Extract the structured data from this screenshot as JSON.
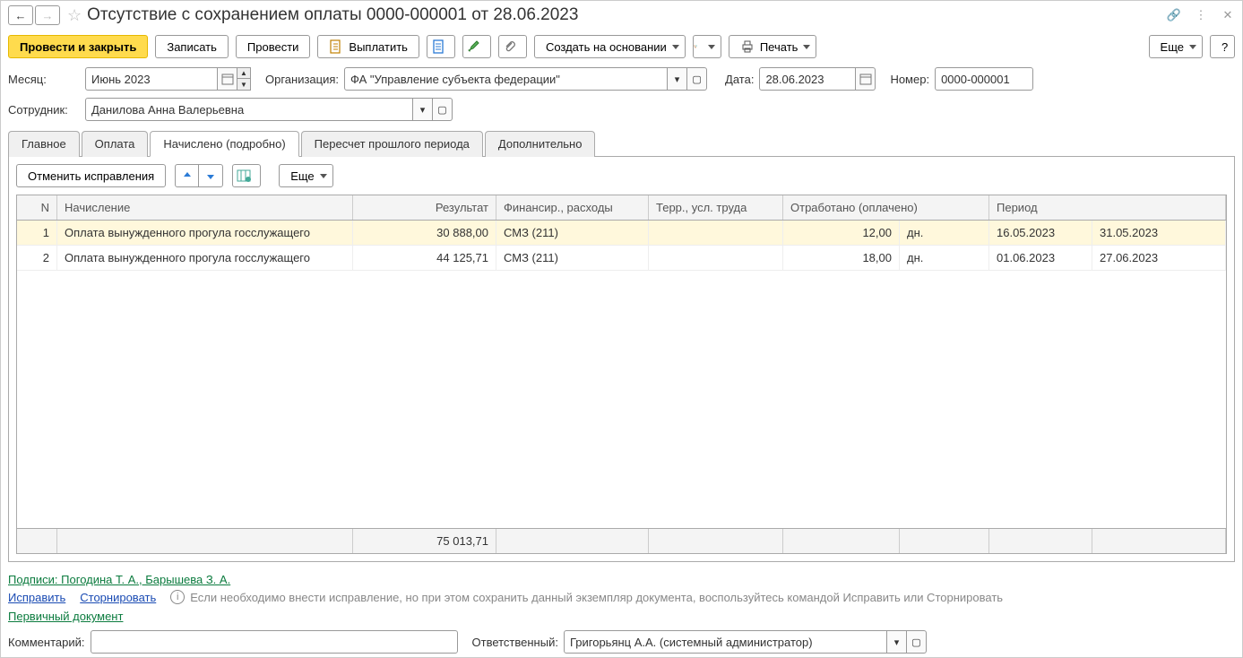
{
  "title": "Отсутствие с сохранением оплаты 0000-000001 от 28.06.2023",
  "toolbar": {
    "post_close": "Провести и закрыть",
    "save": "Записать",
    "post": "Провести",
    "pay": "Выплатить",
    "create_based": "Создать на основании",
    "print": "Печать",
    "more": "Еще"
  },
  "form": {
    "month_label": "Месяц:",
    "month_value": "Июнь 2023",
    "org_label": "Организация:",
    "org_value": "ФА \"Управление субъекта федерации\"",
    "date_label": "Дата:",
    "date_value": "28.06.2023",
    "number_label": "Номер:",
    "number_value": "0000-000001",
    "employee_label": "Сотрудник:",
    "employee_value": "Данилова Анна Валерьевна"
  },
  "tabs": [
    "Главное",
    "Оплата",
    "Начислено (подробно)",
    "Пересчет прошлого периода",
    "Дополнительно"
  ],
  "grid": {
    "toolbar": {
      "cancel_fix": "Отменить исправления",
      "more": "Еще"
    },
    "headers": {
      "n": "N",
      "name": "Начисление",
      "res": "Результат",
      "fin": "Финансир., расходы",
      "terr": "Терр., усл. труда",
      "otr": "Отработано (оплачено)",
      "period": "Период"
    },
    "rows": [
      {
        "n": "1",
        "name": "Оплата вынужденного прогула госслужащего",
        "res": "30 888,00",
        "fin": "СМЗ (211)",
        "terr": "",
        "otr": "12,00",
        "unit": "дн.",
        "p1": "16.05.2023",
        "p2": "31.05.2023"
      },
      {
        "n": "2",
        "name": "Оплата вынужденного прогула госслужащего",
        "res": "44 125,71",
        "fin": "СМЗ (211)",
        "terr": "",
        "otr": "18,00",
        "unit": "дн.",
        "p1": "01.06.2023",
        "p2": "27.06.2023"
      }
    ],
    "total_res": "75 013,71"
  },
  "footer": {
    "signatures": "Подписи: Погодина Т. А., Барышева З. А.",
    "fix": "Исправить",
    "storno": "Сторнировать",
    "info": "Если необходимо внести исправление, но при этом сохранить данный экземпляр документа, воспользуйтесь командой Исправить или Сторнировать",
    "primary_doc": "Первичный документ",
    "comment_label": "Комментарий:",
    "comment_value": "",
    "responsible_label": "Ответственный:",
    "responsible_value": "Григорьянц А.А. (системный администратор)"
  }
}
